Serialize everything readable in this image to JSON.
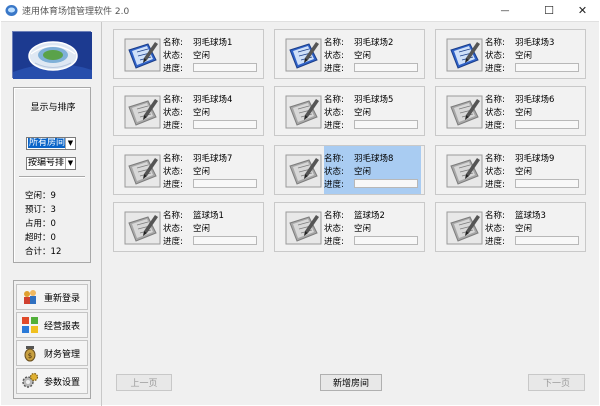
{
  "window": {
    "title": "速用体育场馆管理软件 2.0",
    "minimize_glyph": "—",
    "maximize_glyph": "☐",
    "close_glyph": "✕"
  },
  "sidebar": {
    "panel_title": "显示与排序",
    "filter_value": "所有房间",
    "sort_value": "按编号排",
    "stats": [
      {
        "label": "空闲",
        "value": "9"
      },
      {
        "label": "预订",
        "value": "3"
      },
      {
        "label": "占用",
        "value": "0"
      },
      {
        "label": "超时",
        "value": "0"
      },
      {
        "label": "合计",
        "value": "12"
      }
    ],
    "menu": [
      {
        "label": "重新登录",
        "icon": "login-icon"
      },
      {
        "label": "经营报表",
        "icon": "report-icon"
      },
      {
        "label": "财务管理",
        "icon": "finance-icon"
      },
      {
        "label": "参数设置",
        "icon": "settings-icon"
      }
    ]
  },
  "card_labels": {
    "name": "名称:",
    "status": "状态:",
    "progress": "进度:"
  },
  "rooms": [
    {
      "name": "羽毛球场1",
      "status": "空闲",
      "highlight": true
    },
    {
      "name": "羽毛球场2",
      "status": "空闲",
      "highlight": true
    },
    {
      "name": "羽毛球场3",
      "status": "空闲",
      "highlight": true
    },
    {
      "name": "羽毛球场4",
      "status": "空闲",
      "highlight": false
    },
    {
      "name": "羽毛球场5",
      "status": "空闲",
      "highlight": false
    },
    {
      "name": "羽毛球场6",
      "status": "空闲",
      "highlight": false
    },
    {
      "name": "羽毛球场7",
      "status": "空闲",
      "highlight": false
    },
    {
      "name": "羽毛球场8",
      "status": "空闲",
      "highlight": false,
      "selected": true
    },
    {
      "name": "羽毛球场9",
      "status": "空闲",
      "highlight": false
    },
    {
      "name": "篮球场1",
      "status": "空闲",
      "highlight": false
    },
    {
      "name": "篮球场2",
      "status": "空闲",
      "highlight": false
    },
    {
      "name": "篮球场3",
      "status": "空闲",
      "highlight": false
    }
  ],
  "footer": {
    "prev_label": "上一页",
    "add_label": "新增房间",
    "next_label": "下一页"
  }
}
